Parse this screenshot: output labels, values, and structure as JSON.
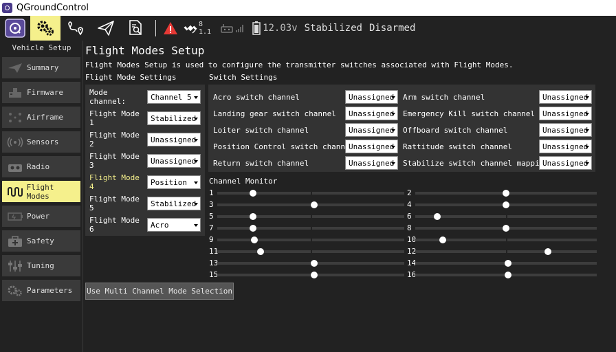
{
  "window": {
    "title": "QGroundControl"
  },
  "toolbar": {
    "gps_count": "8",
    "gps_hdop": "1.1",
    "battery": "12.03v",
    "flight_mode": "Stabilized",
    "arm_state": "Disarmed"
  },
  "sidebar": {
    "title": "Vehicle Setup",
    "items": [
      {
        "label": "Summary",
        "icon": "paper-plane-icon"
      },
      {
        "label": "Firmware",
        "icon": "firmware-icon"
      },
      {
        "label": "Airframe",
        "icon": "airframe-icon"
      },
      {
        "label": "Sensors",
        "icon": "sensors-icon"
      },
      {
        "label": "Radio",
        "icon": "radio-icon"
      },
      {
        "label": "Flight Modes",
        "icon": "flight-modes-icon"
      },
      {
        "label": "Power",
        "icon": "power-icon"
      },
      {
        "label": "Safety",
        "icon": "safety-icon"
      },
      {
        "label": "Tuning",
        "icon": "tuning-icon"
      },
      {
        "label": "Parameters",
        "icon": "parameters-icon"
      }
    ],
    "active_index": 5
  },
  "main": {
    "title": "Flight Modes Setup",
    "description": "Flight Modes Setup is used to configure the transmitter switches associated with Flight Modes.",
    "flight_mode_settings_label": "Flight Mode Settings",
    "switch_settings_label": "Switch Settings",
    "channel_monitor_label": "Channel Monitor",
    "multi_channel_button": "Use Multi Channel Mode Selection"
  },
  "flight_mode_settings": [
    {
      "label": "Mode channel:",
      "value": "Channel 5"
    },
    {
      "label": "Flight Mode 1",
      "value": "Stabilized"
    },
    {
      "label": "Flight Mode 2",
      "value": "Unassigned"
    },
    {
      "label": "Flight Mode 3",
      "value": "Unassigned"
    },
    {
      "label": "Flight Mode 4",
      "value": "Position",
      "highlight": true
    },
    {
      "label": "Flight Mode 5",
      "value": "Stabilized"
    },
    {
      "label": "Flight Mode 6",
      "value": "Acro"
    }
  ],
  "switch_settings": {
    "left": [
      {
        "label": "Acro switch channel",
        "value": "Unassigned"
      },
      {
        "label": "Landing gear switch channel",
        "value": "Unassigned"
      },
      {
        "label": "Loiter switch channel",
        "value": "Unassigned"
      },
      {
        "label": "Position Control switch channel",
        "value": "Unassigned"
      },
      {
        "label": "Return switch channel",
        "value": "Unassigned"
      }
    ],
    "right": [
      {
        "label": "Arm switch channel",
        "value": "Unassigned"
      },
      {
        "label": "Emergency Kill switch channel",
        "value": "Unassigned"
      },
      {
        "label": "Offboard switch channel",
        "value": "Unassigned"
      },
      {
        "label": "Rattitude switch channel",
        "value": "Unassigned"
      },
      {
        "label": "Stabilize switch channel mapping",
        "value": "Unassigned"
      }
    ]
  },
  "channels": [
    {
      "num": "1",
      "value": 0.19
    },
    {
      "num": "2",
      "value": 0.5
    },
    {
      "num": "3",
      "value": 0.52
    },
    {
      "num": "4",
      "value": 0.5
    },
    {
      "num": "5",
      "value": 0.19
    },
    {
      "num": "6",
      "value": 0.12
    },
    {
      "num": "7",
      "value": 0.19
    },
    {
      "num": "8",
      "value": 0.5
    },
    {
      "num": "9",
      "value": 0.2
    },
    {
      "num": "10",
      "value": 0.15
    },
    {
      "num": "11",
      "value": 0.23
    },
    {
      "num": "12",
      "value": 0.73
    },
    {
      "num": "13",
      "value": 0.52
    },
    {
      "num": "14",
      "value": 0.51
    },
    {
      "num": "15",
      "value": 0.52
    },
    {
      "num": "16",
      "value": 0.51
    }
  ],
  "colors": {
    "accent": "#f5f08c",
    "panel": "#333333",
    "background": "#222222",
    "warning": "#e53935"
  }
}
